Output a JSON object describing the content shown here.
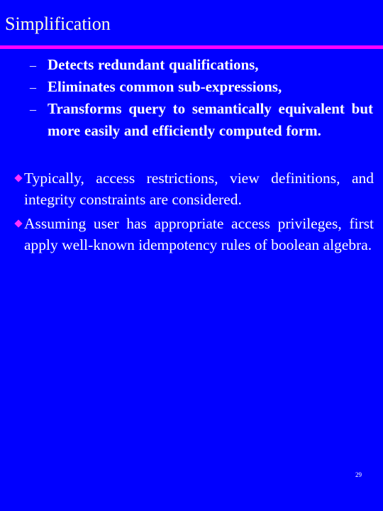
{
  "slide": {
    "title": "Simplification",
    "colors": {
      "background": "#0000FF",
      "rule": "#FF00FF",
      "bullet": "#FF33FF",
      "title_text": "#FFFFE0",
      "body_text": "#FFFFFF"
    },
    "sub_bullets": [
      {
        "marker": "–",
        "text": "Detects redundant qualifications,"
      },
      {
        "marker": "–",
        "text": "Eliminates common sub-expressions,"
      },
      {
        "marker": "–",
        "text": "Transforms query to semantically equivalent but more easily and efficiently computed form."
      }
    ],
    "bullets": [
      {
        "marker": "diamond-icon",
        "text": "Typically, access restrictions, view definitions, and integrity constraints are considered."
      },
      {
        "marker": "diamond-icon",
        "text": "Assuming user has appropriate access privileges, first apply well-known idempotency rules of boolean algebra."
      }
    ],
    "page_number": "29"
  }
}
